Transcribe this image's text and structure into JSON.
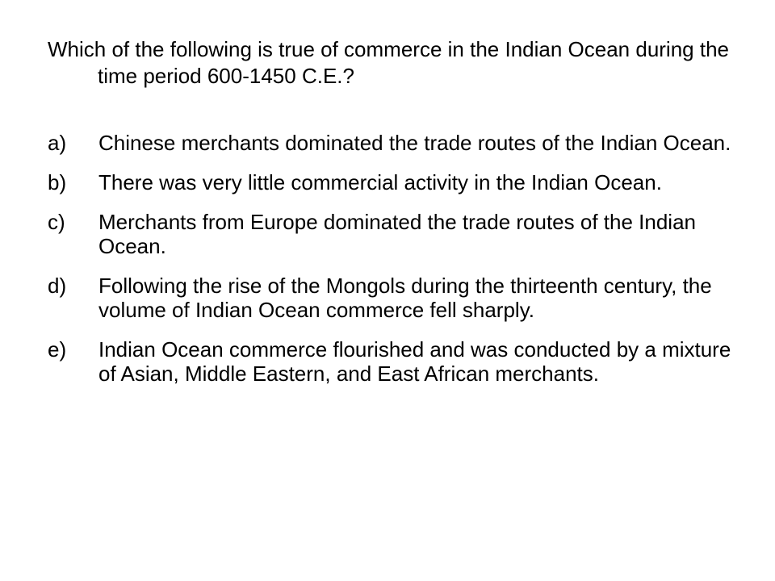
{
  "question": "Which of the following is true of commerce in the Indian Ocean during the time period 600-1450 C.E.?",
  "choices": [
    {
      "letter": "a)",
      "text": "Chinese merchants dominated the trade routes of the Indian Ocean."
    },
    {
      "letter": "b)",
      "text": "There was very little commercial activity in the Indian Ocean."
    },
    {
      "letter": "c)",
      "text": "Merchants from Europe dominated the trade routes of the Indian Ocean."
    },
    {
      "letter": "d)",
      "text": "Following the rise of the Mongols during the thirteenth century, the volume of Indian Ocean commerce fell sharply."
    },
    {
      "letter": "e)",
      "text": "Indian Ocean commerce flourished and was conducted by a mixture of Asian, Middle Eastern, and East African merchants."
    }
  ]
}
